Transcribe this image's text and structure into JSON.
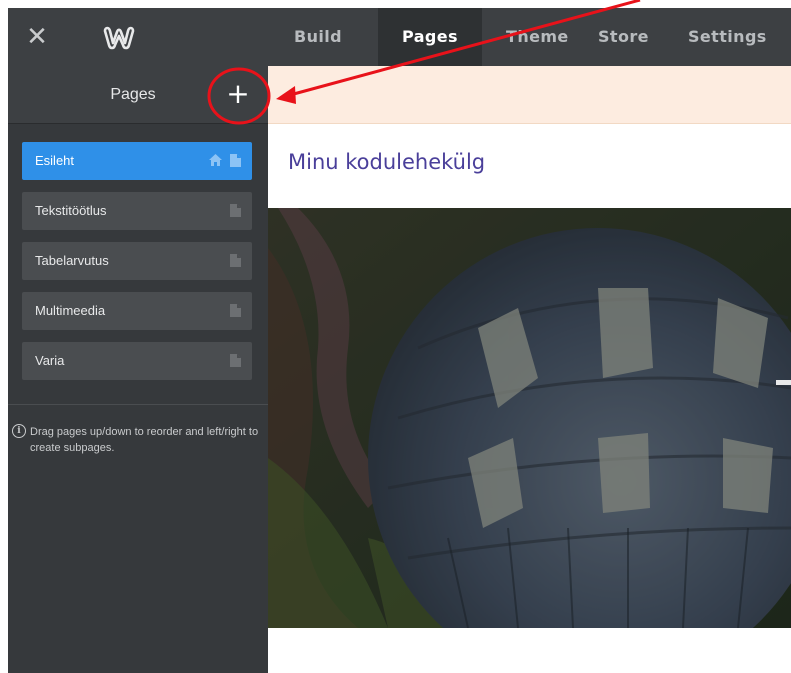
{
  "app": {
    "close_glyph": "✕",
    "logo_icon": "weebly-logo"
  },
  "nav": {
    "tabs": [
      {
        "label": "Build",
        "active": false
      },
      {
        "label": "Pages",
        "active": true
      },
      {
        "label": "Theme",
        "active": false
      },
      {
        "label": "Store",
        "active": false
      },
      {
        "label": "Settings",
        "active": false
      }
    ]
  },
  "sidebar": {
    "title": "Pages",
    "add_glyph": "+",
    "pages": [
      {
        "label": "Esileht",
        "selected": true,
        "home": true
      },
      {
        "label": "Tekstitöötlus",
        "selected": false,
        "home": false
      },
      {
        "label": "Tabelarvutus",
        "selected": false,
        "home": false
      },
      {
        "label": "Multimeedia",
        "selected": false,
        "home": false
      },
      {
        "label": "Varia",
        "selected": false,
        "home": false
      }
    ],
    "hint_icon_glyph": "i",
    "hint": "Drag pages up/down to reorder and left/right to create subpages."
  },
  "main": {
    "site_title": "Minu kodulehekülg"
  },
  "colors": {
    "topbar": "#3d4043",
    "sidebar": "#36393c",
    "selected": "#2f90e8",
    "title_text": "#4a3f9a",
    "notice": "#fdece0",
    "annotation": "#e8121a"
  }
}
